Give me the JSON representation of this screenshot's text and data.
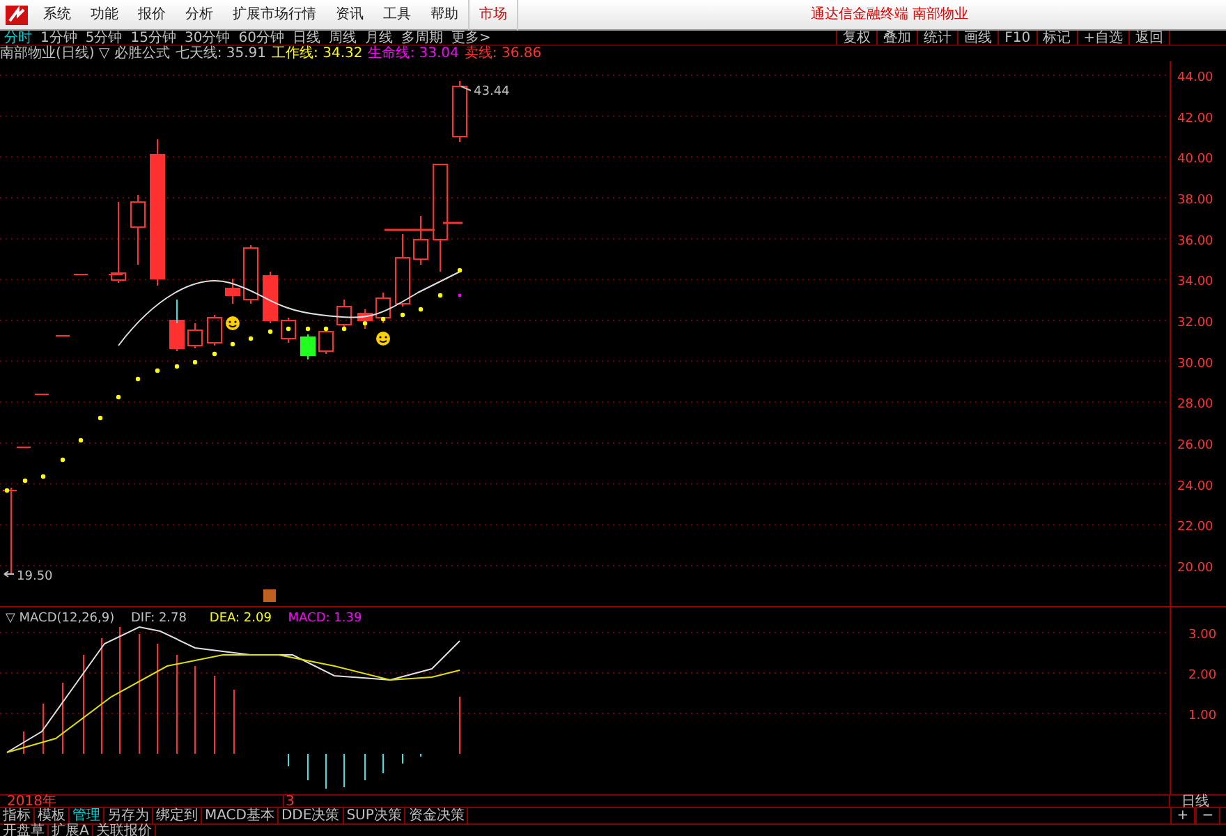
{
  "menu": {
    "items": [
      {
        "label": "系统",
        "kind": "normal"
      },
      {
        "label": "功能",
        "kind": "normal"
      },
      {
        "label": "报价",
        "kind": "normal"
      },
      {
        "label": "分析",
        "kind": "normal"
      },
      {
        "label": "扩展市场行情",
        "kind": "normal"
      },
      {
        "label": "资讯",
        "kind": "normal"
      },
      {
        "label": "工具",
        "kind": "normal"
      },
      {
        "label": "帮助",
        "kind": "normal"
      },
      {
        "label": "市场",
        "kind": "accent"
      }
    ],
    "title": "通达信金融终端  南部物业"
  },
  "periods": [
    {
      "label": "分时",
      "selected": true
    },
    {
      "label": "1分钟",
      "selected": false
    },
    {
      "label": "5分钟",
      "selected": false
    },
    {
      "label": "15分钟",
      "selected": false
    },
    {
      "label": "30分钟",
      "selected": false
    },
    {
      "label": "60分钟",
      "selected": false
    },
    {
      "label": "日线",
      "selected": false
    },
    {
      "label": "周线",
      "selected": false
    },
    {
      "label": "月线",
      "selected": false
    },
    {
      "label": "多周期",
      "selected": false
    },
    {
      "label": "更多>",
      "selected": false
    }
  ],
  "tools": [
    "复权",
    "叠加",
    "统计",
    "画线",
    "F10",
    "标记",
    "+自选",
    "返回"
  ],
  "legend": [
    {
      "text": "南部物业(日线) ▽ 必胜公式",
      "color": "#c0c0c0"
    },
    {
      "text": "七天线: 35.91",
      "color": "#c0c0c0"
    },
    {
      "text": "工作线: 34.32",
      "color": "#ffff00"
    },
    {
      "text": "生命线: 33.04",
      "color": "#ff00ff"
    },
    {
      "text": "卖线: 36.86",
      "color": "#ff3030"
    }
  ],
  "price_axis": {
    "labels": [
      "44.00",
      "42.00",
      "40.00",
      "38.00",
      "36.00",
      "34.00",
      "32.00",
      "30.00",
      "28.00",
      "26.00",
      "24.00",
      "22.00",
      "20.00"
    ]
  },
  "high_label": "43.44",
  "low_label": "19.50",
  "macd_legend": [
    {
      "text": "▽ MACD(12,26,9)",
      "color": "#c0c0c0"
    },
    {
      "text": "DIF: 2.78",
      "color": "#c0c0c0"
    },
    {
      "text": "DEA: 2.09",
      "color": "#ffff00"
    },
    {
      "text": "MACD: 1.39",
      "color": "#ff00ff"
    }
  ],
  "macd_axis": {
    "labels": [
      "3.00",
      "2.00",
      "1.00"
    ]
  },
  "date_row": {
    "year": "2018年",
    "month": "3",
    "period": "日线"
  },
  "bottom_tabs": [
    {
      "label": "指标",
      "selected": false
    },
    {
      "label": "模板",
      "selected": false
    },
    {
      "label": "管理",
      "selected": true
    },
    {
      "label": "另存为",
      "selected": false
    },
    {
      "label": "绑定到",
      "selected": false
    },
    {
      "label": "MACD基本",
      "selected": false
    },
    {
      "label": "DDE决策",
      "selected": false
    },
    {
      "label": "SUP决策",
      "selected": false
    },
    {
      "label": "资金决策",
      "selected": false
    }
  ],
  "zoom_buttons": [
    "+",
    "−"
  ],
  "last_row": [
    "开盘草",
    "扩展A",
    "关联报价"
  ]
}
